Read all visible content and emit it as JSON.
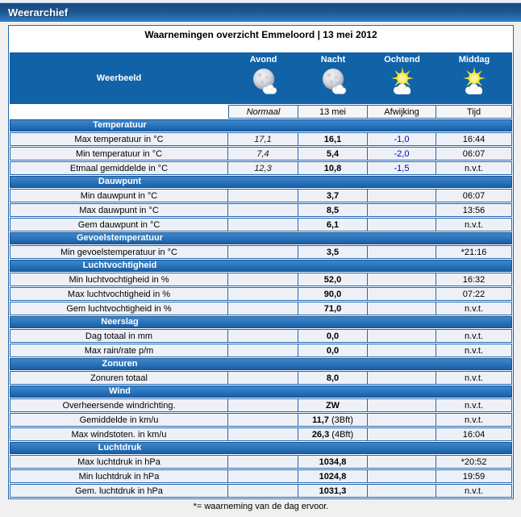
{
  "header": {
    "title": "Weerarchief"
  },
  "colors": {
    "titlebar_top": "#194a80",
    "titlebar_bottom": "#2f7ec4",
    "band_blue": "#1162a7",
    "section_bar_top": "#3a87ce",
    "section_bar_bottom": "#1a5fa5",
    "table_border": "#2268b0",
    "row_background": "#edf1f7",
    "afwijking_text": "#0000cc",
    "page_background": "#f0f0f1"
  },
  "table": {
    "title": "Waarnemingen overzicht Emmeloord | 13 mei 2012",
    "weerbeeld_label": "Weerbeeld",
    "columns": [
      {
        "label": "Avond",
        "icon": "moon-cloud-icon"
      },
      {
        "label": "Nacht",
        "icon": "moon-cloud-icon"
      },
      {
        "label": "Ochtend",
        "icon": "sun-cloud-icon"
      },
      {
        "label": "Middag",
        "icon": "sun-cloud-icon"
      }
    ],
    "subheaders": [
      "Normaal",
      "13 mei",
      "Afwijking",
      "Tijd"
    ],
    "sections": [
      {
        "title": "Temperatuur",
        "rows": [
          {
            "label": "Max temperatuur in °C",
            "normaal": "17,1",
            "value": "16,1",
            "afwijking": "-1,0",
            "tijd": "16:44"
          },
          {
            "label": "Min temperatuur in °C",
            "normaal": "7,4",
            "value": "5,4",
            "afwijking": "-2,0",
            "tijd": "06:07"
          },
          {
            "label": "Etmaal gemiddelde in °C",
            "normaal": "12,3",
            "value": "10,8",
            "afwijking": "-1,5",
            "tijd": "n.v.t."
          }
        ]
      },
      {
        "title": "Dauwpunt",
        "rows": [
          {
            "label": "Min dauwpunt in °C",
            "value": "3,7",
            "tijd": "06:07"
          },
          {
            "label": "Max dauwpunt in °C",
            "value": "8,5",
            "tijd": "13:56"
          },
          {
            "label": "Gem dauwpunt in °C",
            "value": "6,1",
            "tijd": "n.v.t."
          }
        ]
      },
      {
        "title": "Gevoelstemperatuur",
        "rows": [
          {
            "label": "Min gevoelstemperatuur in °C",
            "value": "3,5",
            "tijd": "*21:16"
          }
        ]
      },
      {
        "title": "Luchtvochtigheid",
        "rows": [
          {
            "label": "Min luchtvochtigheid in %",
            "value": "52,0",
            "tijd": "16:32"
          },
          {
            "label": "Max luchtvochtigheid in %",
            "value": "90,0",
            "tijd": "07:22"
          },
          {
            "label": "Gem luchtvochtigheid in %",
            "value": "71,0",
            "tijd": "n.v.t."
          }
        ]
      },
      {
        "title": "Neerslag",
        "rows": [
          {
            "label": "Dag totaal in mm",
            "value": "0,0",
            "tijd": "n.v.t."
          },
          {
            "label": "Max rain/rate p/m",
            "value": "0,0",
            "tijd": "n.v.t."
          }
        ]
      },
      {
        "title": "Zonuren",
        "rows": [
          {
            "label": "Zonuren totaal",
            "value": "8,0",
            "tijd": "n.v.t."
          }
        ]
      },
      {
        "title": "Wind",
        "rows": [
          {
            "label": "Overheersende windrichting.",
            "value": "ZW",
            "tijd": "n.v.t."
          },
          {
            "label": "Gemiddelde in km/u",
            "value": "11,7",
            "suffix": "(3Bft)",
            "tijd": "n.v.t."
          },
          {
            "label": "Max windstoten. in km/u",
            "value": "26,3",
            "suffix": "(4Bft)",
            "tijd": "16:04"
          }
        ]
      },
      {
        "title": "Luchtdruk",
        "rows": [
          {
            "label": "Max luchtdruk in hPa",
            "value": "1034,8",
            "tijd": "*20:52"
          },
          {
            "label": "Min luchtdruk in hPa",
            "value": "1024,8",
            "tijd": "19:59"
          },
          {
            "label": "Gem. luchtdruk in hPa",
            "value": "1031,3",
            "tijd": "n.v.t."
          }
        ]
      }
    ],
    "footnote": "*= waarneming van de dag ervoor."
  }
}
